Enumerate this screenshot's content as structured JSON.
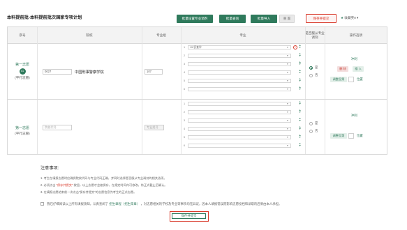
{
  "page_title": "本科提前批-本科提前批次国家专项计划",
  "toolbar": {
    "btn_batch_set": "批量设置专业调剂",
    "btn_batch_query": "批量查询",
    "btn_batch_import": "批量导入",
    "btn_reset": "重 置",
    "btn_save_submit": "保存并提交",
    "favorites_label": "收藏夹0",
    "favorites_count_caret": "▾"
  },
  "table": {
    "headers": [
      "序号",
      "院校",
      "专业组",
      "专业",
      "是否服从专业调剂",
      "操作选项"
    ],
    "rows": [
      {
        "volunteer_label": "第一志愿",
        "volunteer_num": "01",
        "volunteer_sub": "(平行志愿)",
        "school_code": "0027",
        "school_name": "中国刑事警察学院",
        "group_code": "107",
        "majors": [
          {
            "num": "1",
            "value": "15  侦查学"
          },
          {
            "num": "2",
            "value": ""
          },
          {
            "num": "3",
            "value": ""
          },
          {
            "num": "4",
            "value": ""
          },
          {
            "num": "5",
            "value": ""
          },
          {
            "num": "6",
            "value": ""
          }
        ],
        "error_mark": "!",
        "adjust_yes": "是",
        "adjust_no": "否",
        "adjust_selected": "yes",
        "op_top": "冲刺",
        "op_delete": "删 除",
        "op_insert": "插 入",
        "op_adjust": "调整至第",
        "op_adjust_num": "",
        "op_position": "位置"
      },
      {
        "volunteer_label": "第一志愿",
        "volunteer_num": "",
        "volunteer_sub": "(平行志愿)",
        "school_code_placeholder": "院校代号",
        "group_code_placeholder": "专业组号",
        "majors": [
          {
            "num": "1",
            "value": ""
          },
          {
            "num": "2",
            "value": ""
          },
          {
            "num": "3",
            "value": ""
          },
          {
            "num": "4",
            "value": ""
          },
          {
            "num": "5",
            "value": ""
          },
          {
            "num": "6",
            "value": ""
          }
        ],
        "adjust_yes": "是",
        "adjust_no": "否",
        "op_top": "冲刺",
        "op_adjust": "调整至第",
        "op_position": "位置"
      }
    ]
  },
  "notes": {
    "title": "注意事项:",
    "items": [
      "1. 考生在填报志愿时应确保院校代码与专业代码正确，并同时选择是否服从专业调剂的相关选项。",
      "2. 必须点击",
      "“保存并提交”",
      "按钮，以上志愿才会被保存，在规定时间内可修改，待正式截止后确认。",
      "3. 在填报志愿结束前一次点击“保存并提交”的志愿信息为考生的正式志愿。"
    ]
  },
  "agreement": {
    "prefix": "我已仔细阅读以上所有填报须知，认真查阅了",
    "link": "招生章程（招生简章）",
    "suffix": "，对志愿相关的学校及专业等事项均无异议，因本人填报错误而影响志愿投档和录取的后果由本人承担。"
  },
  "bottom_button": "保存并提交",
  "colors": {
    "primary": "#2f7a5c",
    "highlight": "#d93a2b"
  }
}
